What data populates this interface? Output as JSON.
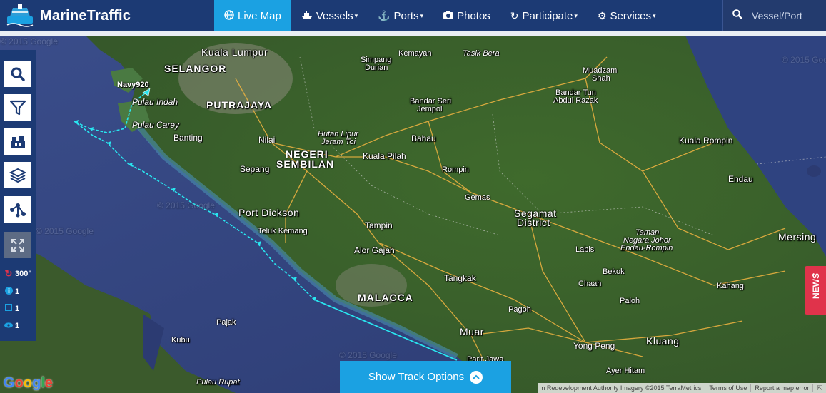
{
  "brand": {
    "name": "MarineTraffic"
  },
  "nav": {
    "items": [
      {
        "label": "Live Map",
        "icon": "globe-icon",
        "glyph": "●",
        "active": true,
        "dropdown": false
      },
      {
        "label": "Vessels",
        "icon": "ship-icon",
        "glyph": "⛴",
        "active": false,
        "dropdown": true
      },
      {
        "label": "Ports",
        "icon": "anchor-icon",
        "glyph": "⚓",
        "active": false,
        "dropdown": true
      },
      {
        "label": "Photos",
        "icon": "camera-icon",
        "glyph": "▣",
        "active": false,
        "dropdown": false
      },
      {
        "label": "Participate",
        "icon": "refresh-icon",
        "glyph": "↻",
        "active": false,
        "dropdown": true
      },
      {
        "label": "Services",
        "icon": "gear-icon",
        "glyph": "⚙",
        "active": false,
        "dropdown": true
      }
    ],
    "caret": "▾"
  },
  "search": {
    "placeholder": "Vessel/Port",
    "icon": "search-icon"
  },
  "toolbar": {
    "refresh": "300\"",
    "info_count": "1",
    "square_count": "1",
    "eye_count": "1"
  },
  "map": {
    "places": [
      {
        "id": "kuala-lumpur",
        "label": "Kuala Lumpur",
        "style": "big"
      },
      {
        "id": "selangor",
        "label": "SELANGOR",
        "style": "state"
      },
      {
        "id": "putrajaya",
        "label": "PUTRAJAYA",
        "style": "state"
      },
      {
        "id": "pulau-indah",
        "label": "Pulau Indah",
        "style": "italic"
      },
      {
        "id": "pulau-carey",
        "label": "Pulau Carey",
        "style": "italic"
      },
      {
        "id": "banting",
        "label": "Banting",
        "style": ""
      },
      {
        "id": "nilai",
        "label": "Nilai",
        "style": ""
      },
      {
        "id": "sepang",
        "label": "Sepang",
        "style": ""
      },
      {
        "id": "negeri",
        "label": "NEGERI",
        "style": "state"
      },
      {
        "id": "sembilan",
        "label": "SEMBILAN",
        "style": "state"
      },
      {
        "id": "hutan-lipur",
        "label": "Hutan Lipur",
        "style": "italic"
      },
      {
        "id": "jeram-toi",
        "label": "Jeram Toi",
        "style": "italic"
      },
      {
        "id": "kuala-pilah",
        "label": "Kuala Pilah",
        "style": ""
      },
      {
        "id": "simpang",
        "label": "Simpang",
        "style": ""
      },
      {
        "id": "durian",
        "label": "Durian",
        "style": ""
      },
      {
        "id": "kemayan",
        "label": "Kemayan",
        "style": ""
      },
      {
        "id": "tasik-bera",
        "label": "Tasik Bera",
        "style": "italic"
      },
      {
        "id": "bandar-seri",
        "label": "Bandar Seri",
        "style": ""
      },
      {
        "id": "jempol",
        "label": "Jempol",
        "style": ""
      },
      {
        "id": "bahau",
        "label": "Bahau",
        "style": ""
      },
      {
        "id": "rompin",
        "label": "Rompin",
        "style": ""
      },
      {
        "id": "gemas",
        "label": "Gemas",
        "style": ""
      },
      {
        "id": "muadzam",
        "label": "Muadzam",
        "style": ""
      },
      {
        "id": "shah",
        "label": "Shah",
        "style": ""
      },
      {
        "id": "bandar-tun",
        "label": "Bandar Tun",
        "style": ""
      },
      {
        "id": "abdul-razak",
        "label": "Abdul Razak",
        "style": ""
      },
      {
        "id": "kuala-rompin",
        "label": "Kuala Rompin",
        "style": ""
      },
      {
        "id": "endau",
        "label": "Endau",
        "style": ""
      },
      {
        "id": "segamat",
        "label": "Segamat",
        "style": "big"
      },
      {
        "id": "district",
        "label": "District",
        "style": "big"
      },
      {
        "id": "port-dickson",
        "label": "Port Dickson",
        "style": "big"
      },
      {
        "id": "teluk-kemang",
        "label": "Teluk Kemang",
        "style": ""
      },
      {
        "id": "tampin",
        "label": "Tampin",
        "style": ""
      },
      {
        "id": "alor-gajah",
        "label": "Alor Gajah",
        "style": ""
      },
      {
        "id": "malacca",
        "label": "MALACCA",
        "style": "state"
      },
      {
        "id": "tangkak",
        "label": "Tangkak",
        "style": ""
      },
      {
        "id": "pagoh",
        "label": "Pagoh",
        "style": ""
      },
      {
        "id": "muar",
        "label": "Muar",
        "style": "big"
      },
      {
        "id": "parit-jawa",
        "label": "Parit Jawa",
        "style": ""
      },
      {
        "id": "labis",
        "label": "Labis",
        "style": ""
      },
      {
        "id": "bekok",
        "label": "Bekok",
        "style": ""
      },
      {
        "id": "chaah",
        "label": "Chaah",
        "style": ""
      },
      {
        "id": "paloh",
        "label": "Paloh",
        "style": ""
      },
      {
        "id": "yong-peng",
        "label": "Yong Peng",
        "style": ""
      },
      {
        "id": "kluang",
        "label": "Kluang",
        "style": "big"
      },
      {
        "id": "ayer-hitam",
        "label": "Ayer Hitam",
        "style": ""
      },
      {
        "id": "kahang",
        "label": "Kahang",
        "style": ""
      },
      {
        "id": "mersing",
        "label": "Mersing",
        "style": "big"
      },
      {
        "id": "taman",
        "label": "Taman",
        "style": "italic"
      },
      {
        "id": "negara-johor",
        "label": "Negara Johor",
        "style": "italic"
      },
      {
        "id": "endau-rompin",
        "label": "Endau-Rompin",
        "style": "italic"
      },
      {
        "id": "pajak",
        "label": "Pajak",
        "style": ""
      },
      {
        "id": "kubu",
        "label": "Kubu",
        "style": ""
      },
      {
        "id": "pulau-rupat",
        "label": "Pulau Rupat",
        "style": "italic"
      }
    ],
    "vessel": {
      "label": "Navy920"
    },
    "watermarks": [
      "© 2015 Google",
      "© 2015 Google",
      "© 2015 Google",
      "© 2015 Google",
      "© 2015 Google"
    ]
  },
  "track_button": {
    "label": "Show Track Options",
    "icon": "chevron-up-icon",
    "glyph": "⌃"
  },
  "news_tab": {
    "label": "NEWS",
    "icon": "chevron-left-icon",
    "glyph": "‹"
  },
  "attribution": {
    "imagery": "n Redevelopment Authority Imagery ©2015 TerraMetrics",
    "terms": "Terms of Use",
    "report": "Report a map error"
  },
  "google_logo": {
    "g1": "G",
    "g2": "o",
    "g3": "o",
    "g4": "g",
    "g5": "l",
    "g6": "e"
  },
  "colors": {
    "navbar": "#1c3a74",
    "accent": "#1ba1e2",
    "news": "#e0334b",
    "track": "#29e6f0"
  }
}
